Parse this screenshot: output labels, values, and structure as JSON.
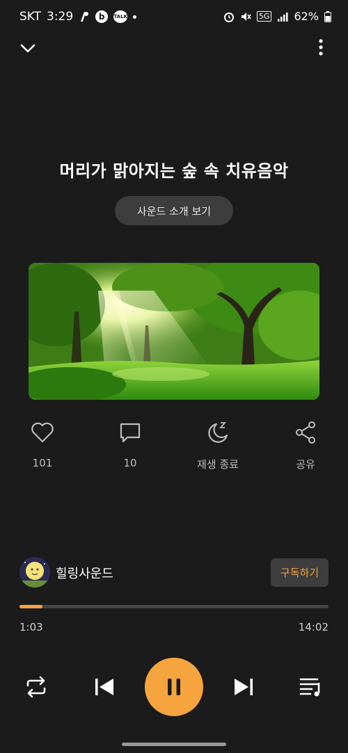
{
  "status_bar": {
    "carrier": "SKT",
    "time": "3:29",
    "b_badge": "b",
    "talk_badge": "TALK",
    "network": "5G",
    "battery": "62%"
  },
  "track": {
    "title": "머리가 맑아지는 숲 속 치유음악",
    "intro_button": "사운드 소개 보기"
  },
  "actions": {
    "like_count": "101",
    "comment_count": "10",
    "sleep_timer_label": "재생 종료",
    "share_label": "공유"
  },
  "channel": {
    "name": "힐링사운드",
    "subscribe_label": "구독하기"
  },
  "player": {
    "current_time": "1:03",
    "total_time": "14:02",
    "progress_fraction": 0.075
  },
  "colors": {
    "accent": "#f6a43e",
    "background": "#1b1b1b"
  }
}
